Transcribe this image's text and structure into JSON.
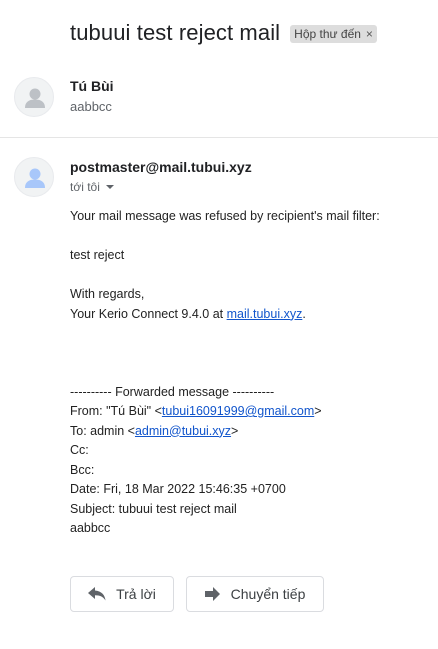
{
  "thread": {
    "subject": "tubuui test reject mail",
    "label": "Hộp thư đến",
    "label_remove": "×"
  },
  "message1": {
    "sender": "Tú Bùi",
    "snippet": "aabbcc",
    "avatar_icon": "person-icon"
  },
  "message2": {
    "sender": "postmaster@mail.tubui.xyz",
    "to_label": "tới tôi",
    "avatar_icon": "person-icon",
    "body": {
      "intro": "Your mail message was refused by recipient's mail filter:",
      "reason": "test reject",
      "regards": "With regards,",
      "signature_prefix": "Your  Kerio Connect 9.4.0 at ",
      "signature_link": "mail.tubui.xyz",
      "signature_suffix": ".",
      "forward_header": "---------- Forwarded message ----------",
      "from_prefix": "From: \"Tú Bùi\" <",
      "from_email": "tubui16091999@gmail.com",
      "from_suffix": ">",
      "to_prefix": "To: admin <",
      "to_email": "admin@tubui.xyz",
      "to_suffix": ">",
      "cc": "Cc:",
      "bcc": "Bcc:",
      "date": "Date: Fri, 18 Mar 2022 15:46:35 +0700",
      "subject": "Subject: tubuui test reject mail",
      "content": "aabbcc"
    }
  },
  "actions": {
    "reply_label": "Trả lời",
    "forward_label": "Chuyển tiếp"
  }
}
